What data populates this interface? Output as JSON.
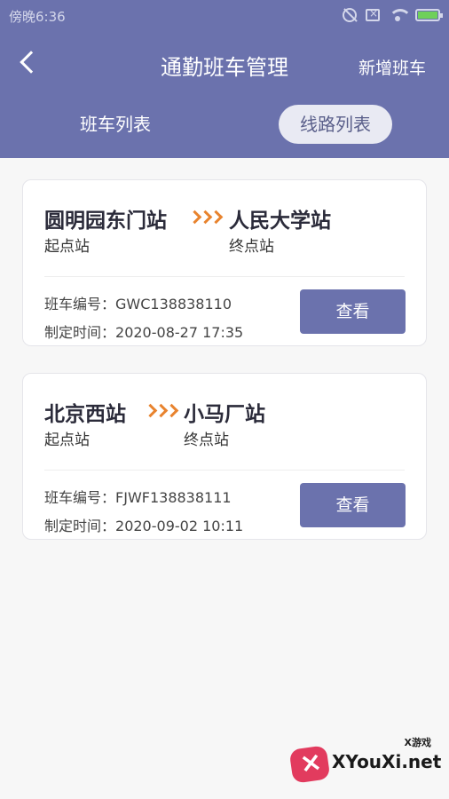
{
  "status": {
    "time": "傍晚6:36"
  },
  "header": {
    "title": "通勤班车管理",
    "add_label": "新增班车"
  },
  "tabs": [
    {
      "label": "班车列表",
      "active": false
    },
    {
      "label": "线路列表",
      "active": true
    }
  ],
  "routes": [
    {
      "start": "圆明园东门站",
      "start_label": "起点站",
      "end": "人民大学站",
      "end_label": "终点站",
      "code_label": "班车编号：",
      "code": "GWC138838110",
      "time_label": "制定时间：",
      "time": "2020-08-27 17:35",
      "view_label": "查看"
    },
    {
      "start": "北京西站",
      "start_label": "起点站",
      "end": "小马厂站",
      "end_label": "终点站",
      "code_label": "班车编号：",
      "code": "FJWF138838111",
      "time_label": "制定时间：",
      "time": "2020-09-02 10:11",
      "view_label": "查看"
    }
  ],
  "watermark": {
    "text": "XYouXi.net",
    "small": "X游戏"
  },
  "colors": {
    "primary": "#6b72ad",
    "accent": "#e8832e"
  },
  "icons": [
    "mute-icon",
    "sim-icon",
    "wifi-icon",
    "battery-icon",
    "back-chevron-icon",
    "double-chevron-right-icon"
  ]
}
